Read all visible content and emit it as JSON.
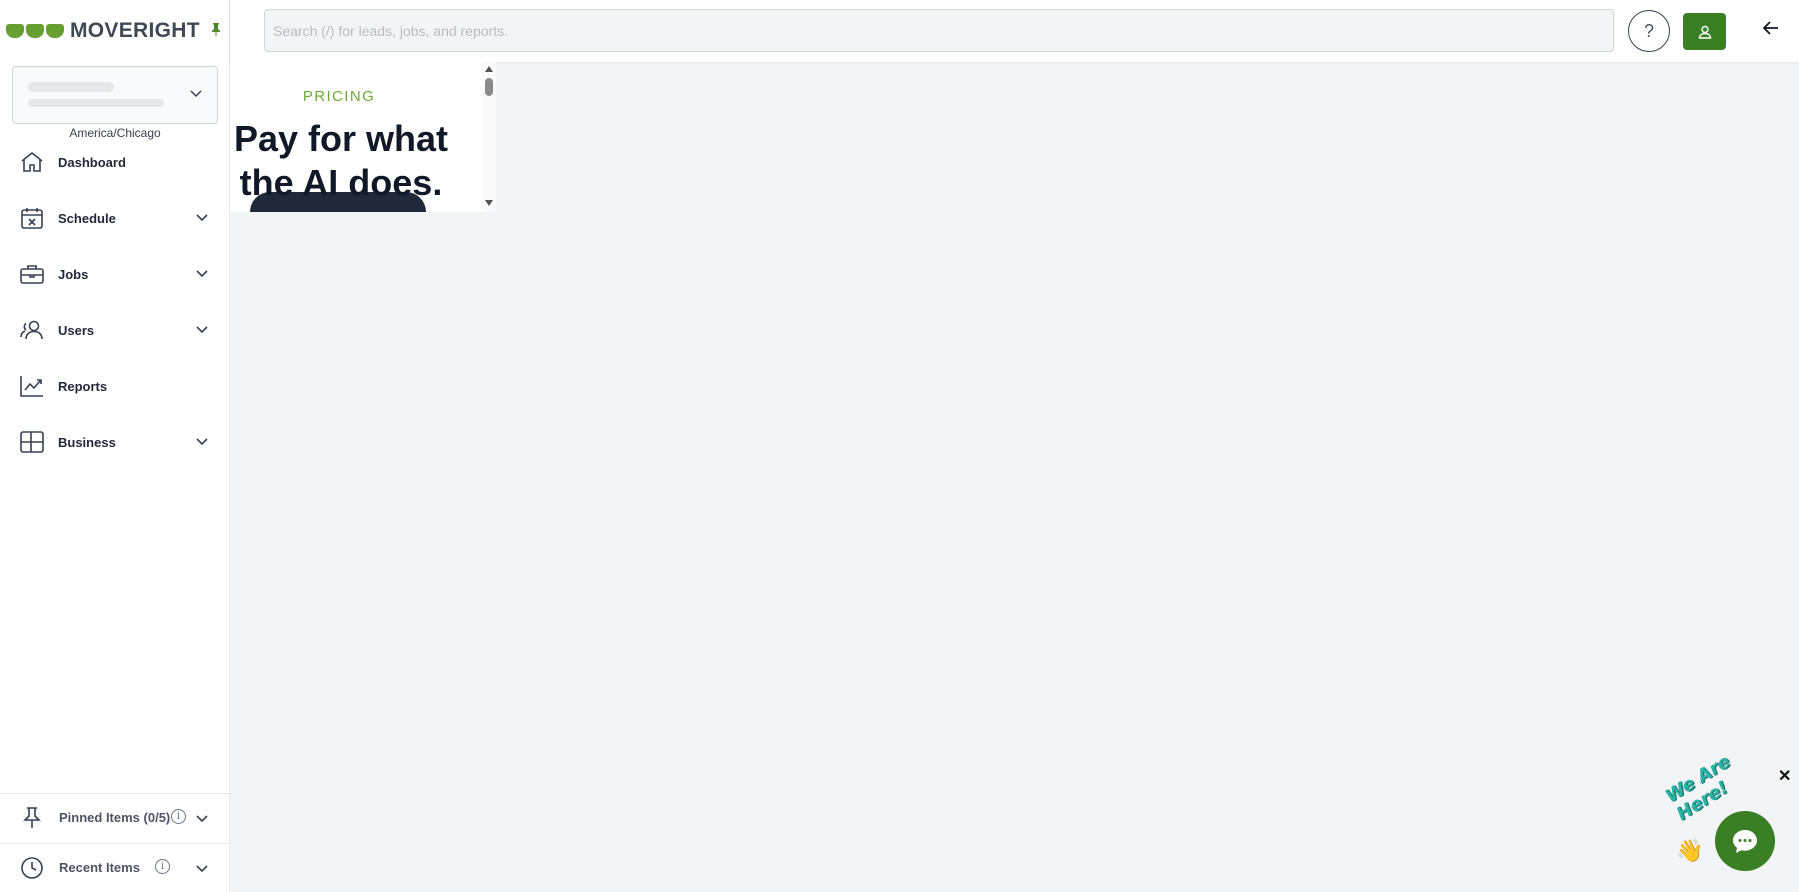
{
  "brand": {
    "name": "MOVERIGHT",
    "accent": "#3a7f25",
    "logo_green": "#66a032"
  },
  "sidebar": {
    "timezone": "America/Chicago",
    "items": [
      {
        "label": "Dashboard",
        "icon": "home-icon",
        "expandable": false
      },
      {
        "label": "Schedule",
        "icon": "calendar-x-icon",
        "expandable": true
      },
      {
        "label": "Jobs",
        "icon": "briefcase-icon",
        "expandable": true
      },
      {
        "label": "Users",
        "icon": "users-icon",
        "expandable": true
      },
      {
        "label": "Reports",
        "icon": "chart-line-icon",
        "expandable": false
      },
      {
        "label": "Business",
        "icon": "grid-icon",
        "expandable": true
      }
    ],
    "pinned_label": "Pinned Items (0/5)",
    "recent_label": "Recent Items",
    "info_glyph": "i"
  },
  "header": {
    "search_placeholder": "Search (/) for leads, jobs, and reports.",
    "help_glyph": "?"
  },
  "embed": {
    "eyebrow": "PRICING",
    "headline": "Pay for what the AI does."
  },
  "chat": {
    "badge_text": "We Are Here!",
    "close_glyph": "✕",
    "wave_glyph": "👋"
  }
}
